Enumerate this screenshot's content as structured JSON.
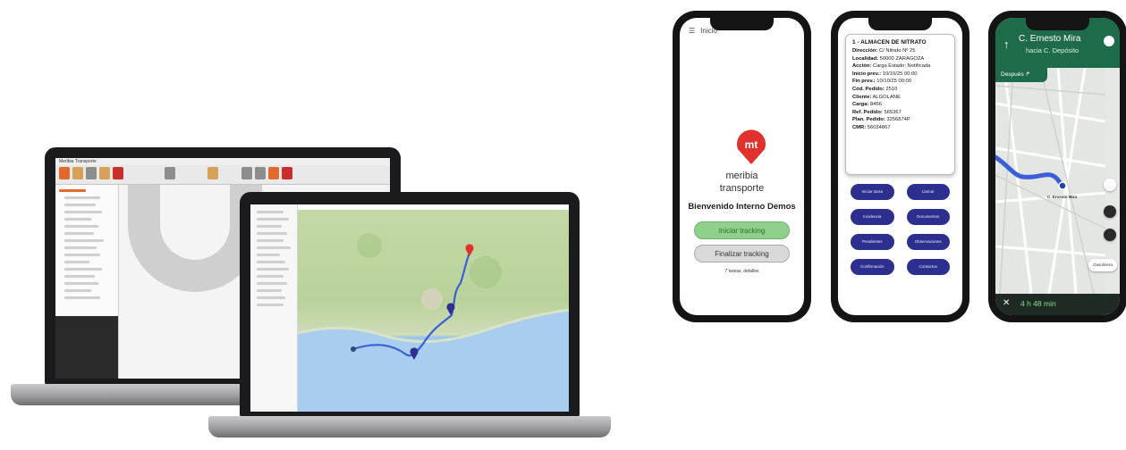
{
  "phone1": {
    "menu_label": "Inicio",
    "logo_text": "mt",
    "brand_line1": "meribia",
    "brand_line2": "transporte",
    "welcome": "Bienvenido Interno Demos",
    "start_button": "Iniciar tracking",
    "stop_button": "Finalizar tracking",
    "footer": "7 tareas, detalles"
  },
  "phone2": {
    "task_title": "1 - ALMACEN DE NITRATO",
    "fields": [
      {
        "label": "Dirección:",
        "value": "C/ Nitrato Nº 25"
      },
      {
        "label": "Localidad:",
        "value": "50000 ZARAGOZA"
      },
      {
        "label": "Acción:",
        "value": "Carga  Estado: Notificada"
      },
      {
        "label": "Inicio prev.:",
        "value": "10/10/25 00:00"
      },
      {
        "label": "Fin prev.:",
        "value": "10/10/25 00:00"
      },
      {
        "label": "Cód. Pedido:",
        "value": "2510"
      },
      {
        "label": "Cliente:",
        "value": "ALGOLANE"
      },
      {
        "label": "Carga:",
        "value": "8466"
      },
      {
        "label": "Ref. Pedido:",
        "value": "565367"
      },
      {
        "label": "Plan. Pedido:",
        "value": "3256874P"
      },
      {
        "label": "CMR:",
        "value": "56034867"
      }
    ],
    "buttons": [
      "Iniciar tarea",
      "Llamar",
      "Incidencia",
      "Documentos",
      "Pendientes",
      "Observaciones",
      "Confirmación",
      "Contactos"
    ]
  },
  "phone3": {
    "street": "C. Ernesto Mira",
    "toward": "hacia C. Depósito",
    "then": "Después",
    "map_label": "C. Ernesto Mira",
    "eta": "4 h 48 min",
    "pill": "Gasolinera"
  },
  "laptop1": {
    "window_title": "Meribia Transporte"
  },
  "colors": {
    "brand_red": "#e0312c",
    "nav_green": "#1e6b4a",
    "button_blue": "#2d2f8f",
    "route_blue": "#3a5fd8"
  }
}
